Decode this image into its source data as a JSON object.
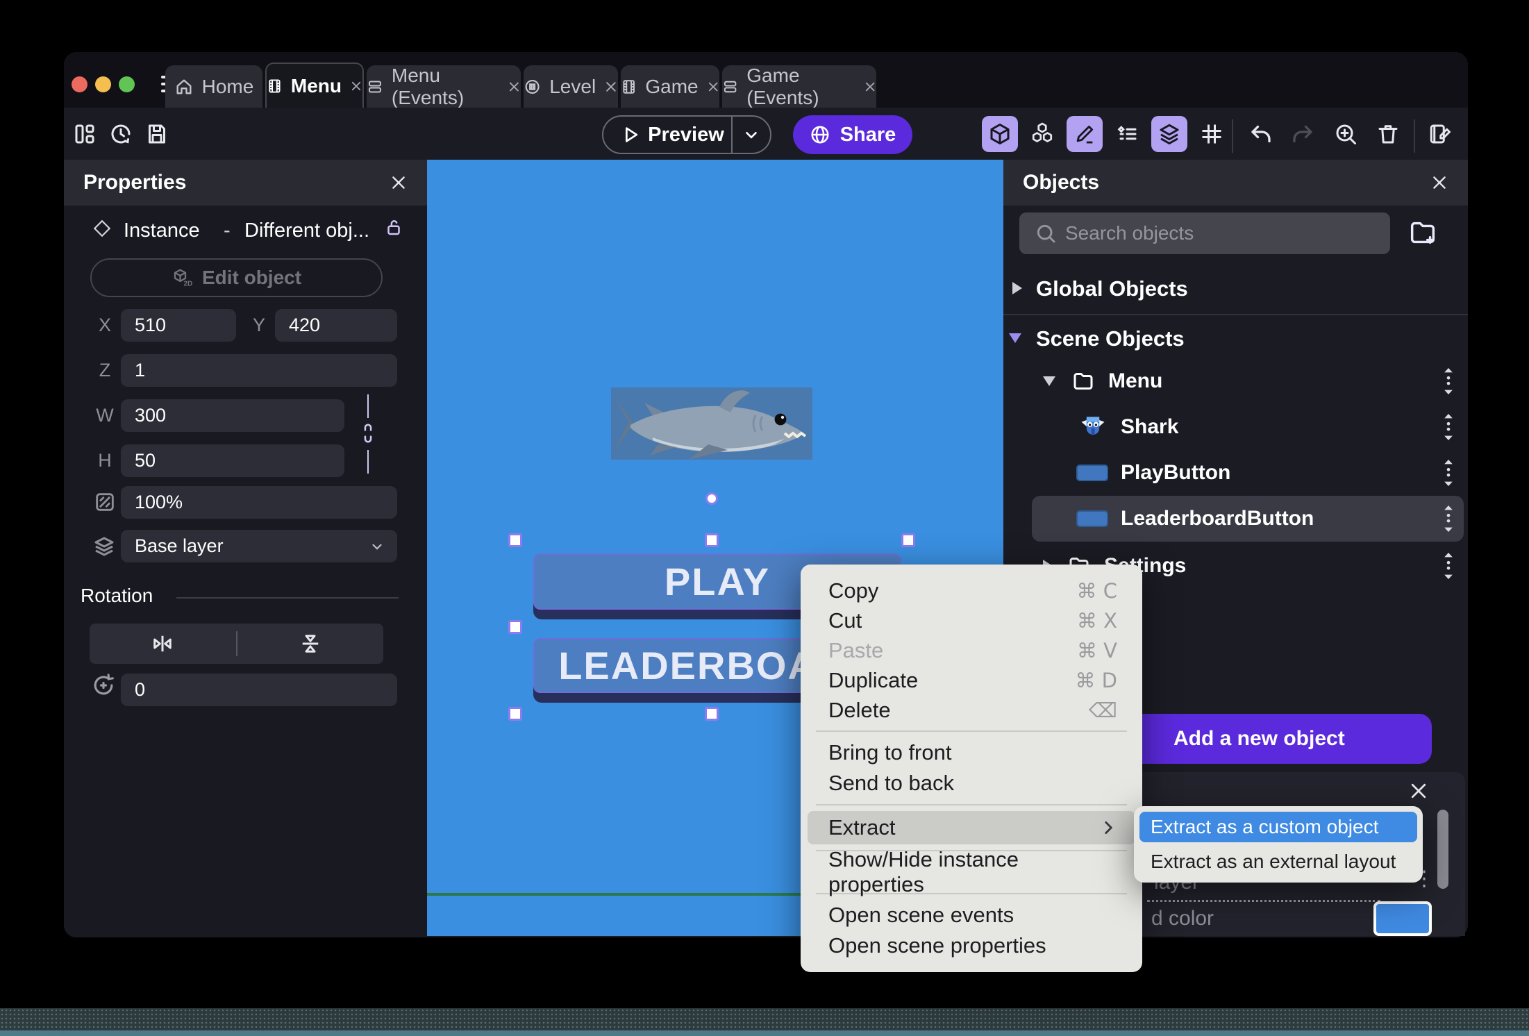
{
  "titlebar": {
    "tabs": [
      {
        "label": "Home"
      },
      {
        "label": "Menu"
      },
      {
        "label": "Menu (Events)"
      },
      {
        "label": "Level"
      },
      {
        "label": "Game"
      },
      {
        "label": "Game (Events)"
      }
    ]
  },
  "toolbar": {
    "preview": "Preview",
    "share": "Share"
  },
  "properties": {
    "title": "Properties",
    "instance_label": "Instance",
    "separator": "-",
    "instance_object": "Different obj...",
    "edit_object": "Edit object",
    "x_label": "X",
    "x": "510",
    "y_label": "Y",
    "y": "420",
    "z_label": "Z",
    "z": "1",
    "w_label": "W",
    "w": "300",
    "h_label": "H",
    "h": "50",
    "opacity": "100%",
    "layer": "Base layer",
    "rotation_title": "Rotation",
    "rotation": "0"
  },
  "canvas": {
    "play": "PLAY",
    "leaderboard": "LEADERBOARD"
  },
  "objects": {
    "title": "Objects",
    "search_placeholder": "Search objects",
    "global_group": "Global Objects",
    "scene_group": "Scene Objects",
    "items": [
      {
        "label": "Menu"
      },
      {
        "label": "Shark"
      },
      {
        "label": "PlayButton"
      },
      {
        "label": "LeaderboardButton"
      },
      {
        "label": "Settings"
      }
    ],
    "add_button": "Add a new object",
    "plus": "+",
    "partial_layer": "layer",
    "partial_color": "d color",
    "overflow_dots": "⋮"
  },
  "menu": {
    "items": [
      {
        "label": "Copy",
        "shortcut": "⌘ C"
      },
      {
        "label": "Cut",
        "shortcut": "⌘ X"
      },
      {
        "label": "Paste",
        "shortcut": "⌘ V"
      },
      {
        "label": "Duplicate",
        "shortcut": "⌘ D"
      },
      {
        "label": "Delete",
        "shortcut": "⌫"
      },
      {
        "label": "Bring to front"
      },
      {
        "label": "Send to back"
      },
      {
        "label": "Extract"
      },
      {
        "label": "Show/Hide instance properties"
      },
      {
        "label": "Open scene events"
      },
      {
        "label": "Open scene properties"
      }
    ]
  },
  "submenu": {
    "items": [
      {
        "label": "Extract as a custom object"
      },
      {
        "label": "Extract as an external layout"
      }
    ]
  },
  "colors": {
    "accent_purple": "#5b2add",
    "active_icon_bg": "#b3a1f2",
    "canvas_blue": "#3a8fe0",
    "selection_blue": "#3f8ae2",
    "button_blue": "#4d7ec1",
    "scene_line_green": "#2c7a4b",
    "swatch_blue": "#3f8ae2"
  }
}
